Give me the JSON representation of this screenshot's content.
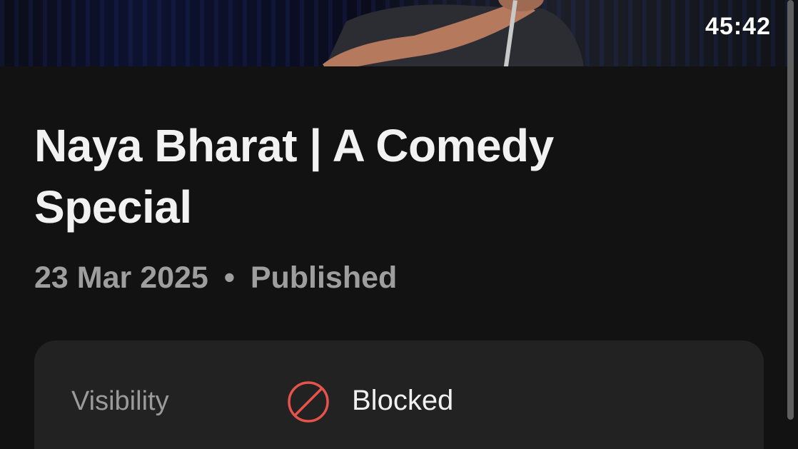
{
  "video": {
    "duration": "45:42",
    "title": "Naya Bharat | A Comedy Special",
    "date": "23 Mar 2025",
    "separator": "•",
    "status": "Published"
  },
  "details": {
    "visibility_label": "Visibility",
    "visibility_value": "Blocked",
    "visibility_icon": "blocked-icon"
  },
  "colors": {
    "background": "#121212",
    "card": "#222222",
    "blocked_red": "#e5534b",
    "meta_gray": "#9e9e9e"
  }
}
